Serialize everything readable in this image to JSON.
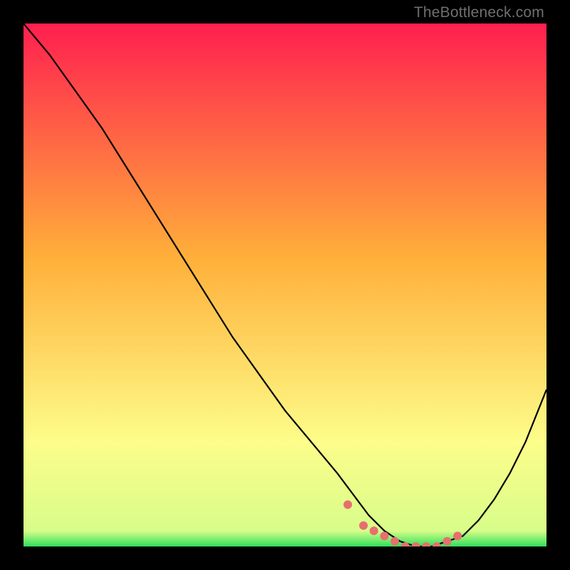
{
  "watermark": "TheBottleneck.com",
  "colors": {
    "gradient_top": "#ff1f4f",
    "gradient_mid": "#ffc23a",
    "gradient_low": "#fdfd8a",
    "gradient_bottom": "#2fe05a",
    "curve": "#000000",
    "marker": "#e76f6f",
    "background": "#000000"
  },
  "chart_data": {
    "type": "line",
    "title": "",
    "xlabel": "",
    "ylabel": "",
    "xlim": [
      0,
      100
    ],
    "ylim": [
      0,
      100
    ],
    "series": [
      {
        "name": "bottleneck-curve",
        "x": [
          0,
          5,
          10,
          15,
          20,
          25,
          30,
          35,
          40,
          45,
          50,
          55,
          60,
          63,
          66,
          69,
          72,
          75,
          78,
          81,
          84,
          87,
          90,
          93,
          96,
          100
        ],
        "y": [
          100,
          94,
          87,
          80,
          72,
          64,
          56,
          48,
          40,
          33,
          26,
          20,
          14,
          10,
          6,
          3,
          1,
          0,
          0,
          1,
          2,
          5,
          9,
          14,
          20,
          30
        ]
      }
    ],
    "markers": {
      "name": "highlight-points",
      "x": [
        62,
        65,
        67,
        69,
        71,
        73,
        75,
        77,
        79,
        81,
        83
      ],
      "y": [
        8,
        4,
        3,
        2,
        1,
        0,
        0,
        0,
        0,
        1,
        2
      ]
    }
  }
}
